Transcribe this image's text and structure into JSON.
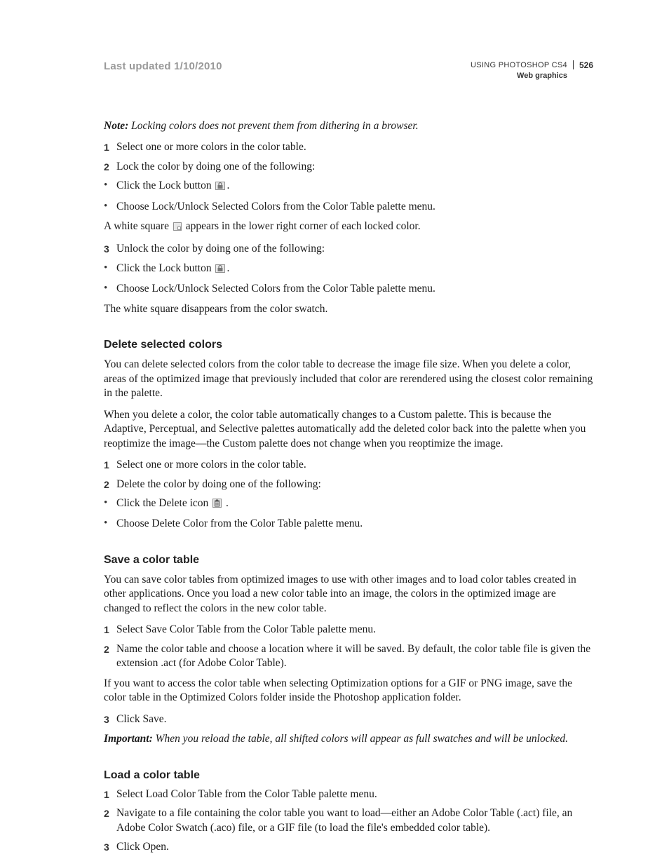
{
  "header": {
    "last_updated": "Last updated 1/10/2010",
    "doc_title": "USING PHOTOSHOP CS4",
    "section_title": "Web graphics",
    "page_number": "526"
  },
  "note": {
    "label": "Note:",
    "text": " Locking colors does not prevent them from dithering in a browser."
  },
  "lock_steps": {
    "s1": "Select one or more colors in the color table.",
    "s2": "Lock the color by doing one of the following:",
    "b2a_pre": "Click the Lock button ",
    "b2a_post": ".",
    "b2b": "Choose Lock/Unlock Selected Colors from the Color Table palette menu.",
    "after2_pre": "A white square ",
    "after2_post": " appears in the lower right corner of each locked color.",
    "s3": "Unlock the color by doing one of the following:",
    "b3a_pre": "Click the Lock button ",
    "b3a_post": ".",
    "b3b": "Choose Lock/Unlock Selected Colors from the Color Table palette menu.",
    "after3": "The white square disappears from the color swatch."
  },
  "delete": {
    "heading": "Delete selected colors",
    "p1": "You can delete selected colors from the color table to decrease the image file size. When you delete a color, areas of the optimized image that previously included that color are rerendered using the closest color remaining in the palette.",
    "p2": "When you delete a color, the color table automatically changes to a Custom palette. This is because the Adaptive, Perceptual, and Selective palettes automatically add the deleted color back into the palette when you reoptimize the image—the Custom palette does not change when you reoptimize the image.",
    "s1": "Select one or more colors in the color table.",
    "s2": "Delete the color by doing one of the following:",
    "b2a_pre": "Click the Delete icon ",
    "b2a_post": " .",
    "b2b": "Choose Delete Color from the Color Table palette menu."
  },
  "save": {
    "heading": "Save a color table",
    "p1": "You can save color tables from optimized images to use with other images and to load color tables created in other applications. Once you load a new color table into an image, the colors in the optimized image are changed to reflect the colors in the new color table.",
    "s1": "Select Save Color Table from the Color Table palette menu.",
    "s2": "Name the color table and choose a location where it will be saved. By default, the color table file is given the extension .act (for Adobe Color Table).",
    "p2": "If you want to access the color table when selecting Optimization options for a GIF or PNG image, save the color table in the Optimized Colors folder inside the Photoshop application folder.",
    "s3": "Click Save.",
    "important_label": "Important:",
    "important_text": " When you reload the table, all shifted colors will appear as full swatches and will be unlocked."
  },
  "load": {
    "heading": "Load a color table",
    "s1": "Select Load Color Table from the Color Table palette menu.",
    "s2": "Navigate to a file containing the color table you want to load—either an Adobe Color Table (.act) file, an Adobe Color Swatch (.aco) file, or a GIF file (to load the file's embedded color table).",
    "s3": "Click Open."
  }
}
